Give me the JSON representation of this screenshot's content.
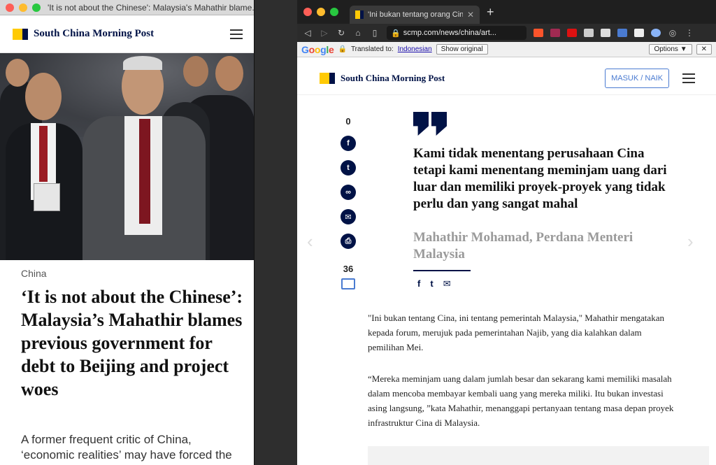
{
  "left_window": {
    "title": "'It is not about the Chinese': Malaysia's Mahathir blame...",
    "brand": "South China Morning Post",
    "category": "China",
    "headline": "‘It is not about the Chinese’: Malaysia’s Mahathir blames previous government for debt to Beijing and project woes",
    "subheadline": "A former frequent critic of China, ‘economic realities’ may have forced the"
  },
  "right_window": {
    "tab_title": "'Ini bukan tentang orang Cina': M",
    "url": "scmp.com/news/china/art...",
    "translate_bar": {
      "google": "Google",
      "translated_to_label": "Translated to:",
      "language": "Indonesian",
      "show_original": "Show original",
      "options": "Options ▼",
      "close": "✕"
    },
    "brand": "South China Morning Post",
    "login_label": "MASUK / NAIK",
    "share_count": "0",
    "comment_count": "36",
    "quote": "Kami tidak menentang perusahaan Cina tetapi kami menentang meminjam uang dari luar dan memiliki proyek-proyek yang tidak perlu dan yang sangat mahal",
    "quote_attribution": "Mahathir Mohamad, Perdana Menteri Malaysia",
    "paragraph1": "\"Ini bukan tentang Cina, ini tentang pemerintah Malaysia,\" Mahathir mengatakan kepada forum, merujuk pada pemerintahan Najib, yang dia kalahkan dalam pemilihan Mei.",
    "paragraph2": "“Mereka meminjam uang dalam jumlah besar dan sekarang kami memiliki masalah dalam mencoba membayar kembali uang yang mereka miliki. Itu bukan investasi asing langsung, ”kata Mahathir, menanggapi pertanyaan tentang masa depan proyek infrastruktur Cina di Malaysia."
  },
  "icons": {
    "facebook": "f",
    "twitter": "t",
    "link": "∞",
    "email": "✉",
    "print": "⎙"
  },
  "colors": {
    "brand_navy": "#001246",
    "brand_yellow": "#ffca05",
    "link_blue": "#4a7bd1"
  }
}
